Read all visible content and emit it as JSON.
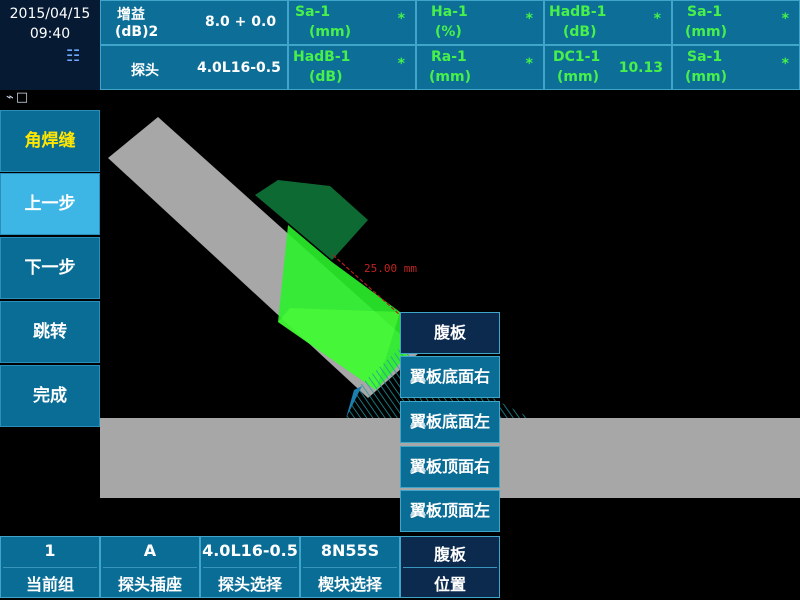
{
  "status": {
    "date": "2015/04/15",
    "time": "09:40"
  },
  "header": {
    "gain": {
      "label1": "增益",
      "label2": "(dB)2",
      "value": "8.0 + 0.0"
    },
    "probe": {
      "label": "探头",
      "value": "4.0L16-0.5"
    },
    "readouts_row1": [
      {
        "label": "Sa-1",
        "unit": "(mm)",
        "value": "*"
      },
      {
        "label": "Ha-1",
        "unit": "(%)",
        "value": "*"
      },
      {
        "label": "HadB-1",
        "unit": "(dB)",
        "value": "*"
      },
      {
        "label": "Sa-1",
        "unit": "(mm)",
        "value": "*"
      }
    ],
    "readouts_row2": [
      {
        "label": "HadB-1",
        "unit": "(dB)",
        "value": "*"
      },
      {
        "label": "Ra-1",
        "unit": "(mm)",
        "value": "*"
      },
      {
        "label": "DC1-1",
        "unit": "(mm)",
        "value": "10.13"
      },
      {
        "label": "Sa-1",
        "unit": "(mm)",
        "value": "*"
      }
    ]
  },
  "sidebar": {
    "title": "角焊缝",
    "items": [
      "上一步",
      "下一步",
      "跳转",
      "完成"
    ]
  },
  "canvas": {
    "measure_label": "25.00 mm"
  },
  "dropdown": {
    "selected": "腹板",
    "options": [
      "翼板底面右",
      "翼板底面左",
      "翼板顶面右",
      "翼板顶面左"
    ]
  },
  "bottom": [
    {
      "value": "1",
      "label": "当前组"
    },
    {
      "value": "A",
      "label": "探头插座"
    },
    {
      "value": "4.0L16-0.5",
      "label": "探头选择"
    },
    {
      "value": "8N55S",
      "label": "楔块选择"
    },
    {
      "value": "腹板",
      "label": "位置"
    }
  ],
  "colors": {
    "panel": "#0a6d96",
    "accent_green": "#48f04a",
    "title_yellow": "#ffe600",
    "active_blue": "#3db6e6"
  }
}
